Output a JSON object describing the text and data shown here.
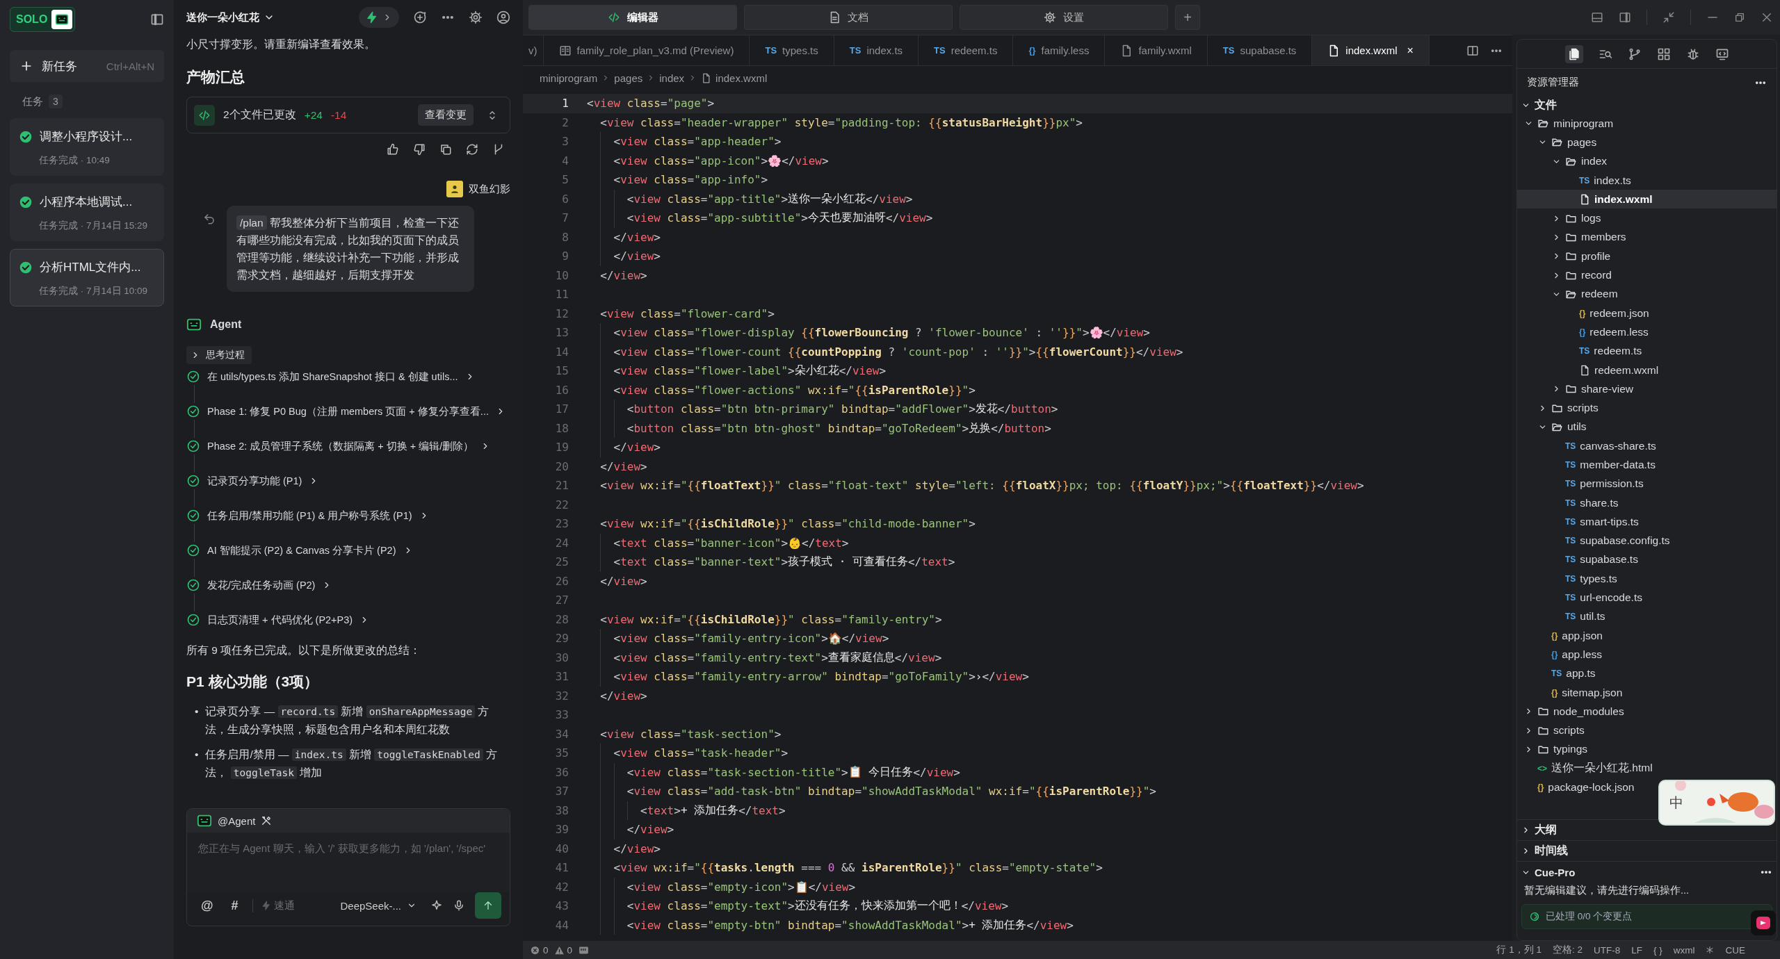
{
  "sidebar": {
    "logo": "SOLO",
    "new_task": {
      "label": "新任务",
      "shortcut": "Ctrl+Alt+N"
    },
    "tasks_label": "任务",
    "tasks_count": "3",
    "tasks": [
      {
        "title": "调整小程序设计...",
        "status": "任务完成 · 10:49",
        "done": true,
        "selected": false
      },
      {
        "title": "小程序本地调试...",
        "status": "任务完成 · 7月14日 15:29",
        "done": true,
        "selected": false
      },
      {
        "title": "分析HTML文件内...",
        "status": "任务完成 · 7月14日 10:09",
        "done": true,
        "selected": true
      }
    ]
  },
  "chat": {
    "title": "送你一朵小红花",
    "fast_mode": {
      "on": true
    },
    "intro": "小尺寸撑变形。请重新编译查看效果。",
    "artifacts_heading": "产物汇总",
    "changes": {
      "label": "2个文件已更改",
      "added": "+24",
      "removed": "-14",
      "button": "查看变更"
    },
    "user": {
      "name": "双鱼幻影",
      "command": "/plan",
      "message": "帮我整体分析下当前项目，检查一下还有哪些功能没有完成，比如我的页面下的成员管理等功能，继续设计补充一下功能，并形成需求文档，越细越好，后期支撑开发"
    },
    "agent": {
      "name": "Agent",
      "thinking": "思考过程",
      "steps": [
        {
          "text": "在 utils/types.ts 添加 ShareSnapshot 接口 & 创建 utils...",
          "done": true
        },
        {
          "text": "Phase 1: 修复 P0 Bug（注册 members 页面 + 修复分享查看...",
          "done": true
        },
        {
          "text": "Phase 2: 成员管理子系统（数据隔离 + 切换 + 编辑/删除）",
          "done": true
        },
        {
          "text": "记录页分享功能 (P1)",
          "done": true
        },
        {
          "text": "任务启用/禁用功能 (P1) & 用户称号系统 (P1)",
          "done": true
        },
        {
          "text": "AI 智能提示 (P2) & Canvas 分享卡片 (P2)",
          "done": true
        },
        {
          "text": "发花/完成任务动画 (P2)",
          "done": true
        },
        {
          "text": "日志页清理 + 代码优化 (P2+P3)",
          "done": true
        }
      ],
      "summary": "所有 9 项任务已完成。以下是所做更改的总结：",
      "heading": "P1 核心功能（3项）",
      "bullets": [
        {
          "marker": "•",
          "parts": [
            {
              "kind": "text",
              "text": "记录页分享 — "
            },
            {
              "kind": "code",
              "text": "record.ts"
            },
            {
              "kind": "text",
              "text": " 新增 "
            },
            {
              "kind": "code",
              "text": "onShareAppMessage"
            },
            {
              "kind": "text",
              "text": " 方法，生成分享快照，标题包含用户名和本周红花数"
            }
          ]
        },
        {
          "marker": "•",
          "parts": [
            {
              "kind": "text",
              "text": "任务启用/禁用 — "
            },
            {
              "kind": "code",
              "text": "index.ts"
            },
            {
              "kind": "text",
              "text": " 新增 "
            },
            {
              "kind": "code",
              "text": "toggleTaskEnabled"
            },
            {
              "kind": "text",
              "text": " 方法， "
            },
            {
              "kind": "code",
              "text": "toggleTask"
            },
            {
              "kind": "text",
              "text": " 增加"
            }
          ]
        }
      ]
    },
    "composer": {
      "mention": "@Agent",
      "placeholder": "您正在与 Agent 聊天，输入 '/' 获取更多能力，如 '/plan', '/spec'",
      "at": "@",
      "hash": "#",
      "mode": "速通",
      "model": "DeepSeek-..."
    }
  },
  "editor": {
    "modes": [
      {
        "label": "编辑器",
        "selected": true
      },
      {
        "label": "文档",
        "selected": false
      },
      {
        "label": "设置",
        "selected": false
      }
    ],
    "add": "+",
    "tabs": [
      {
        "label": "v)",
        "kind": "cut",
        "selected": false
      },
      {
        "label": "family_role_plan_v3.md (Preview)",
        "kind": "md",
        "selected": false
      },
      {
        "label": "types.ts",
        "kind": "ts",
        "badge": "TS",
        "selected": false
      },
      {
        "label": "index.ts",
        "kind": "ts",
        "badge": "TS",
        "selected": false
      },
      {
        "label": "redeem.ts",
        "kind": "ts",
        "badge": "TS",
        "selected": false
      },
      {
        "label": "family.less",
        "kind": "less",
        "badge": "{}",
        "selected": false
      },
      {
        "label": "family.wxml",
        "kind": "file",
        "selected": false
      },
      {
        "label": "supabase.ts",
        "kind": "ts",
        "badge": "TS",
        "selected": false
      },
      {
        "label": "index.wxml",
        "kind": "file",
        "selected": true,
        "close": "×"
      }
    ],
    "breadcrumb": [
      "miniprogram",
      "pages",
      "index",
      "index.wxml"
    ],
    "lines": [
      {
        "n": "1",
        "code": "<view class=\"page\">",
        "current": true
      },
      {
        "n": "2",
        "code": "  <view class=\"header-wrapper\" style=\"padding-top: {{statusBarHeight}}px\">",
        "current": false
      },
      {
        "n": "3",
        "code": "    <view class=\"app-header\">",
        "current": false
      },
      {
        "n": "4",
        "code": "    <view class=\"app-icon\">🌸</view>",
        "current": false
      },
      {
        "n": "5",
        "code": "    <view class=\"app-info\">",
        "current": false
      },
      {
        "n": "6",
        "code": "      <view class=\"app-title\">送你一朵小红花</view>",
        "current": false
      },
      {
        "n": "7",
        "code": "      <view class=\"app-subtitle\">今天也要加油呀</view>",
        "current": false
      },
      {
        "n": "8",
        "code": "    </view>",
        "current": false
      },
      {
        "n": "9",
        "code": "    </view>",
        "current": false
      },
      {
        "n": "10",
        "code": "  </view>",
        "current": false
      },
      {
        "n": "11",
        "current": false
      },
      {
        "n": "12",
        "code": "  <view class=\"flower-card\">",
        "current": false
      },
      {
        "n": "13",
        "code": "    <view class=\"flower-display {{flowerBouncing ? 'flower-bounce' : ''}}\">🌸</view>",
        "current": false
      },
      {
        "n": "14",
        "code": "    <view class=\"flower-count {{countPopping ? 'count-pop' : ''}}\">{{flowerCount}}</view>",
        "current": false
      },
      {
        "n": "15",
        "code": "    <view class=\"flower-label\">朵小红花</view>",
        "current": false
      },
      {
        "n": "16",
        "code": "    <view class=\"flower-actions\" wx:if=\"{{isParentRole}}\">",
        "current": false
      },
      {
        "n": "17",
        "code": "      <button class=\"btn btn-primary\" bindtap=\"addFlower\">发花</button>",
        "current": false
      },
      {
        "n": "18",
        "code": "      <button class=\"btn btn-ghost\" bindtap=\"goToRedeem\">兑换</button>",
        "current": false
      },
      {
        "n": "19",
        "code": "    </view>",
        "current": false
      },
      {
        "n": "20",
        "code": "  </view>",
        "current": false
      },
      {
        "n": "21",
        "code": "  <view wx:if=\"{{floatText}}\" class=\"float-text\" style=\"left: {{floatX}}px; top: {{floatY}}px;\">{{floatText}}</view>",
        "current": false
      },
      {
        "n": "22",
        "current": false
      },
      {
        "n": "23",
        "code": "  <view wx:if=\"{{isChildRole}}\" class=\"child-mode-banner\">",
        "current": false
      },
      {
        "n": "24",
        "code": "    <text class=\"banner-icon\">👶</text>",
        "current": false
      },
      {
        "n": "25",
        "code": "    <text class=\"banner-text\">孩子模式 · 可查看任务</text>",
        "current": false
      },
      {
        "n": "26",
        "code": "  </view>",
        "current": false
      },
      {
        "n": "27",
        "current": false
      },
      {
        "n": "28",
        "code": "  <view wx:if=\"{{isChildRole}}\" class=\"family-entry\">",
        "current": false
      },
      {
        "n": "29",
        "code": "    <view class=\"family-entry-icon\">🏠</view>",
        "current": false
      },
      {
        "n": "30",
        "code": "    <view class=\"family-entry-text\">查看家庭信息</view>",
        "current": false
      },
      {
        "n": "31",
        "code": "    <view class=\"family-entry-arrow\" bindtap=\"goToFamily\">›</view>",
        "current": false
      },
      {
        "n": "32",
        "code": "  </view>",
        "current": false
      },
      {
        "n": "33",
        "current": false
      },
      {
        "n": "34",
        "code": "  <view class=\"task-section\">",
        "current": false
      },
      {
        "n": "35",
        "code": "    <view class=\"task-header\">",
        "current": false
      },
      {
        "n": "36",
        "code": "      <view class=\"task-section-title\">📋 今日任务</view>",
        "current": false
      },
      {
        "n": "37",
        "code": "      <view class=\"add-task-btn\" bindtap=\"showAddTaskModal\" wx:if=\"{{isParentRole}}\">",
        "current": false
      },
      {
        "n": "38",
        "code": "        <text>+ 添加任务</text>",
        "current": false
      },
      {
        "n": "39",
        "code": "      </view>",
        "current": false
      },
      {
        "n": "40",
        "code": "    </view>",
        "current": false
      },
      {
        "n": "41",
        "code": "    <view wx:if=\"{{tasks.length === 0 && isParentRole}}\" class=\"empty-state\">",
        "current": false
      },
      {
        "n": "42",
        "code": "      <view class=\"empty-icon\">📋</view>",
        "current": false
      },
      {
        "n": "43",
        "code": "      <view class=\"empty-text\">还没有任务，快来添加第一个吧！</view>",
        "current": false
      },
      {
        "n": "44",
        "code": "      <view class=\"empty-btn\" bindtap=\"showAddTaskModal\">+ 添加任务</view>",
        "current": false
      }
    ]
  },
  "explorer": {
    "title": "资源管理器",
    "section": "文件",
    "tree": [
      {
        "name": "miniprogram",
        "kind": "folder",
        "expanded": true,
        "children": [
          {
            "name": "pages",
            "kind": "folder",
            "expanded": true,
            "children": [
              {
                "name": "index",
                "kind": "folder",
                "expanded": true,
                "children": [
                  {
                    "name": "index.ts",
                    "kind": "ts",
                    "badge": "TS",
                    "selected": false
                  },
                  {
                    "name": "index.wxml",
                    "kind": "file",
                    "selected": true
                  }
                ]
              },
              {
                "name": "logs",
                "kind": "folder",
                "expanded": false
              },
              {
                "name": "members",
                "kind": "folder",
                "expanded": false
              },
              {
                "name": "profile",
                "kind": "folder",
                "expanded": false
              },
              {
                "name": "record",
                "kind": "folder",
                "expanded": false
              },
              {
                "name": "redeem",
                "kind": "folder",
                "expanded": true,
                "children": [
                  {
                    "name": "redeem.json",
                    "kind": "json",
                    "badge": "{}",
                    "selected": false
                  },
                  {
                    "name": "redeem.less",
                    "kind": "less",
                    "badge": "{}",
                    "selected": false
                  },
                  {
                    "name": "redeem.ts",
                    "kind": "ts",
                    "badge": "TS",
                    "selected": false
                  },
                  {
                    "name": "redeem.wxml",
                    "kind": "file",
                    "selected": false
                  }
                ]
              },
              {
                "name": "share-view",
                "kind": "folder",
                "expanded": false
              }
            ]
          },
          {
            "name": "scripts",
            "kind": "folder",
            "expanded": false
          },
          {
            "name": "utils",
            "kind": "folder",
            "expanded": true,
            "children": [
              {
                "name": "canvas-share.ts",
                "kind": "ts",
                "badge": "TS",
                "selected": false
              },
              {
                "name": "member-data.ts",
                "kind": "ts",
                "badge": "TS",
                "selected": false
              },
              {
                "name": "permission.ts",
                "kind": "ts",
                "badge": "TS",
                "selected": false
              },
              {
                "name": "share.ts",
                "kind": "ts",
                "badge": "TS",
                "selected": false
              },
              {
                "name": "smart-tips.ts",
                "kind": "ts",
                "badge": "TS",
                "selected": false
              },
              {
                "name": "supabase.config.ts",
                "kind": "ts",
                "badge": "TS",
                "selected": false
              },
              {
                "name": "supabase.ts",
                "kind": "ts",
                "badge": "TS",
                "selected": false
              },
              {
                "name": "types.ts",
                "kind": "ts",
                "badge": "TS",
                "selected": false
              },
              {
                "name": "url-encode.ts",
                "kind": "ts",
                "badge": "TS",
                "selected": false
              },
              {
                "name": "util.ts",
                "kind": "ts",
                "badge": "TS",
                "selected": false
              }
            ]
          },
          {
            "name": "app.json",
            "kind": "json",
            "badge": "{}",
            "selected": false
          },
          {
            "name": "app.less",
            "kind": "less",
            "badge": "{}",
            "selected": false
          },
          {
            "name": "app.ts",
            "kind": "ts",
            "badge": "TS",
            "selected": false
          },
          {
            "name": "sitemap.json",
            "kind": "json",
            "badge": "{}",
            "selected": false
          }
        ]
      },
      {
        "name": "node_modules",
        "kind": "folder",
        "expanded": false
      },
      {
        "name": "scripts",
        "kind": "folder",
        "expanded": false
      },
      {
        "name": "typings",
        "kind": "folder",
        "expanded": false
      },
      {
        "name": "送你一朵小红花.html",
        "kind": "html",
        "badge": "<>",
        "selected": false
      },
      {
        "name": "package-lock.json",
        "kind": "json",
        "badge": "{}",
        "selected": false
      }
    ],
    "panels": [
      {
        "title": "大纲",
        "expanded": false
      },
      {
        "title": "时间线",
        "expanded": false
      }
    ],
    "cue": {
      "title": "Cue-Pro",
      "expanded": true,
      "message": "暂无编辑建议，请先进行编码操作...",
      "processed": "已处理 0/0 个变更点"
    },
    "ime": "中"
  },
  "status_bar": {
    "errors": "0",
    "warnings": "0",
    "items": [
      "行 1，列 1",
      "空格: 2",
      "UTF-8",
      "LF",
      "{ }",
      "wxml",
      "CUE"
    ]
  }
}
